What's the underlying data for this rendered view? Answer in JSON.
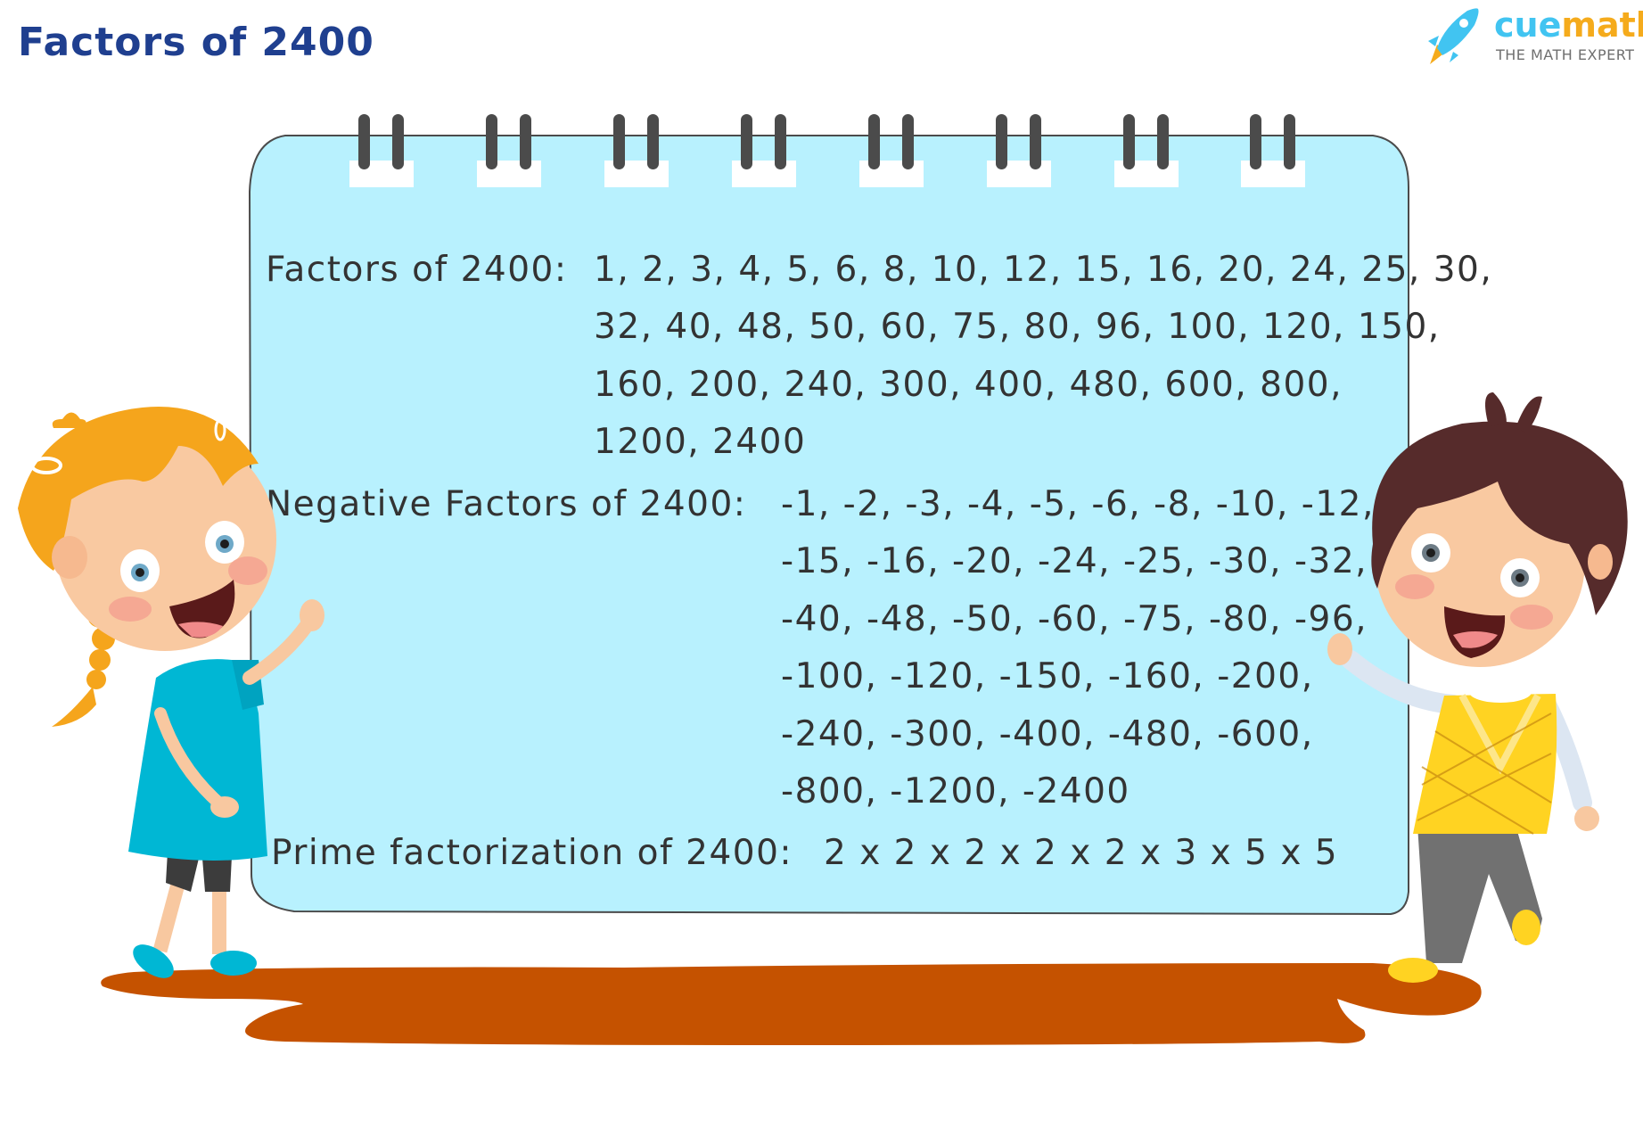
{
  "page": {
    "title": "Factors of 2400"
  },
  "logo": {
    "brand_part1": "cue",
    "brand_part2": "math",
    "tagline": "THE MATH EXPERT",
    "icon": "rocket-icon",
    "colors": {
      "cue": "#41c4f1",
      "math": "#f5ab1c",
      "tagline": "#6f6f6f"
    }
  },
  "board": {
    "color": "#b8f1fe",
    "factors": {
      "label": "Factors of 2400:",
      "lines": [
        "1, 2, 3, 4, 5, 6, 8, 10, 12, 15, 16, 20, 24, 25, 30,",
        "32, 40, 48, 50, 60, 75, 80, 96, 100, 120, 150,",
        "160, 200, 240, 300, 400, 480, 600, 800,",
        "1200, 2400"
      ]
    },
    "negative_factors": {
      "label": "Negative Factors of 2400:",
      "lines": [
        "-1, -2, -3, -4, -5, -6, -8, -10, -12,",
        "-15, -16, -20, -24, -25, -30, -32,",
        "-40, -48, -50, -60, -75, -80, -96,",
        "-100, -120, -150, -160, -200,",
        "-240, -300, -400, -480, -600,",
        "-800, -1200, -2400"
      ]
    },
    "prime_factorization": {
      "label": "Prime factorization of 2400:",
      "value": "2 x 2 x 2 x 2 x 2 x 3 x 5 x 5"
    }
  },
  "illustration": {
    "left_character": "girl-waving",
    "right_character": "boy-waving",
    "ground": "puddle",
    "colors": {
      "puddle": "#c55200",
      "text": "#333333",
      "title": "#1f3f8f"
    }
  }
}
